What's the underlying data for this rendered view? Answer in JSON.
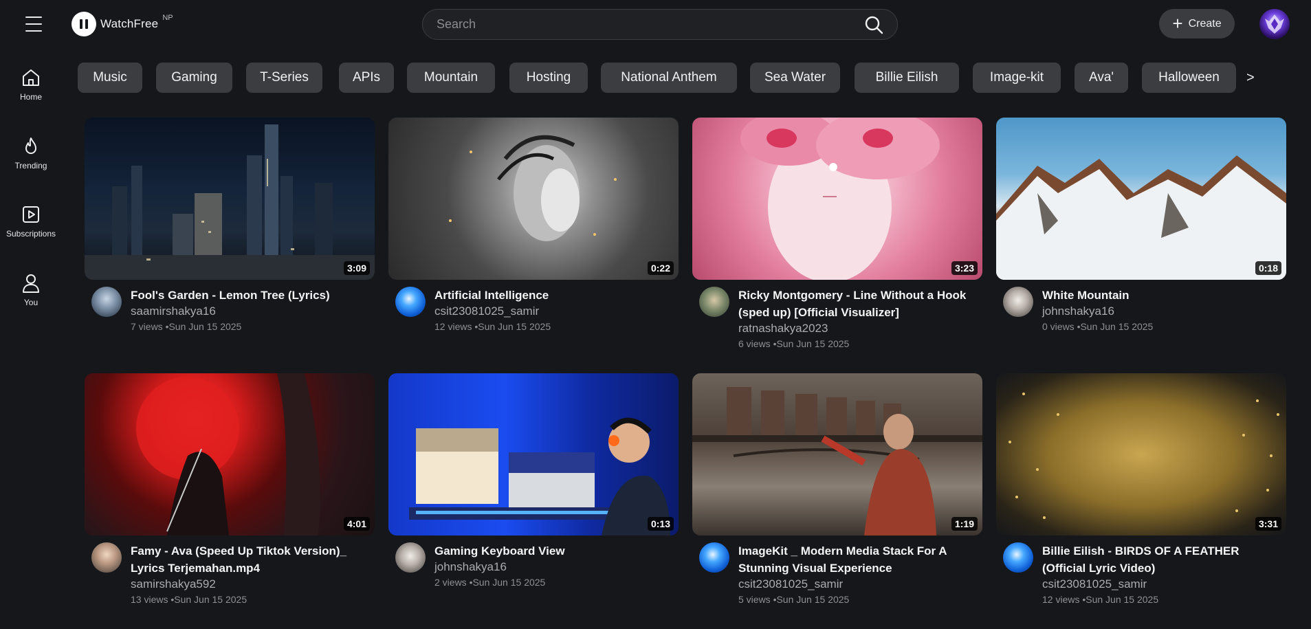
{
  "header": {
    "logo_text": "WatchFree",
    "logo_sup": "NP",
    "search_placeholder": "Search",
    "create_label": "Create"
  },
  "sidebar": {
    "items": [
      {
        "label": "Home",
        "icon": "home-icon"
      },
      {
        "label": "Trending",
        "icon": "flame-icon"
      },
      {
        "label": "Subscriptions",
        "icon": "subscriptions-icon"
      },
      {
        "label": "You",
        "icon": "user-icon"
      }
    ]
  },
  "chips": [
    "Music",
    "Gaming",
    "T-Series",
    "APIs",
    "Mountain",
    "Hosting",
    "National Anthem",
    "Sea Water",
    "Billie Eilish",
    "Image-kit",
    "Ava'",
    "Halloween"
  ],
  "chips_next": ">",
  "videos": [
    {
      "title": "Fool's Garden - Lemon Tree (Lyrics)",
      "channel": "saamirshakya16",
      "stats": "7 views •Sun Jun 15 2025",
      "duration": "3:09"
    },
    {
      "title": "Artificial Intelligence",
      "channel": "csit23081025_samir",
      "stats": "12 views •Sun Jun 15 2025",
      "duration": "0:22"
    },
    {
      "title": "Ricky Montgomery - Line Without a Hook (sped up) [Official Visualizer]",
      "channel": "ratnashakya2023",
      "stats": "6 views •Sun Jun 15 2025",
      "duration": "3:23"
    },
    {
      "title": "White Mountain",
      "channel": "johnshakya16",
      "stats": "0 views •Sun Jun 15 2025",
      "duration": "0:18"
    },
    {
      "title": "Famy - Ava (Speed Up Tiktok Version)_ Lyrics Terjemahan.mp4",
      "channel": "samirshakya592",
      "stats": "13 views •Sun Jun 15 2025",
      "duration": "4:01"
    },
    {
      "title": "Gaming Keyboard View",
      "channel": "johnshakya16",
      "stats": "2 views •Sun Jun 15 2025",
      "duration": "0:13"
    },
    {
      "title": "ImageKit _ Modern Media Stack For A Stunning Visual Experience",
      "channel": "csit23081025_samir",
      "stats": "5 views •Sun Jun 15 2025",
      "duration": "1:19"
    },
    {
      "title": "Billie Eilish - BIRDS OF A FEATHER (Official Lyric Video)",
      "channel": "csit23081025_samir",
      "stats": "12 views •Sun Jun 15 2025",
      "duration": "3:31"
    }
  ]
}
